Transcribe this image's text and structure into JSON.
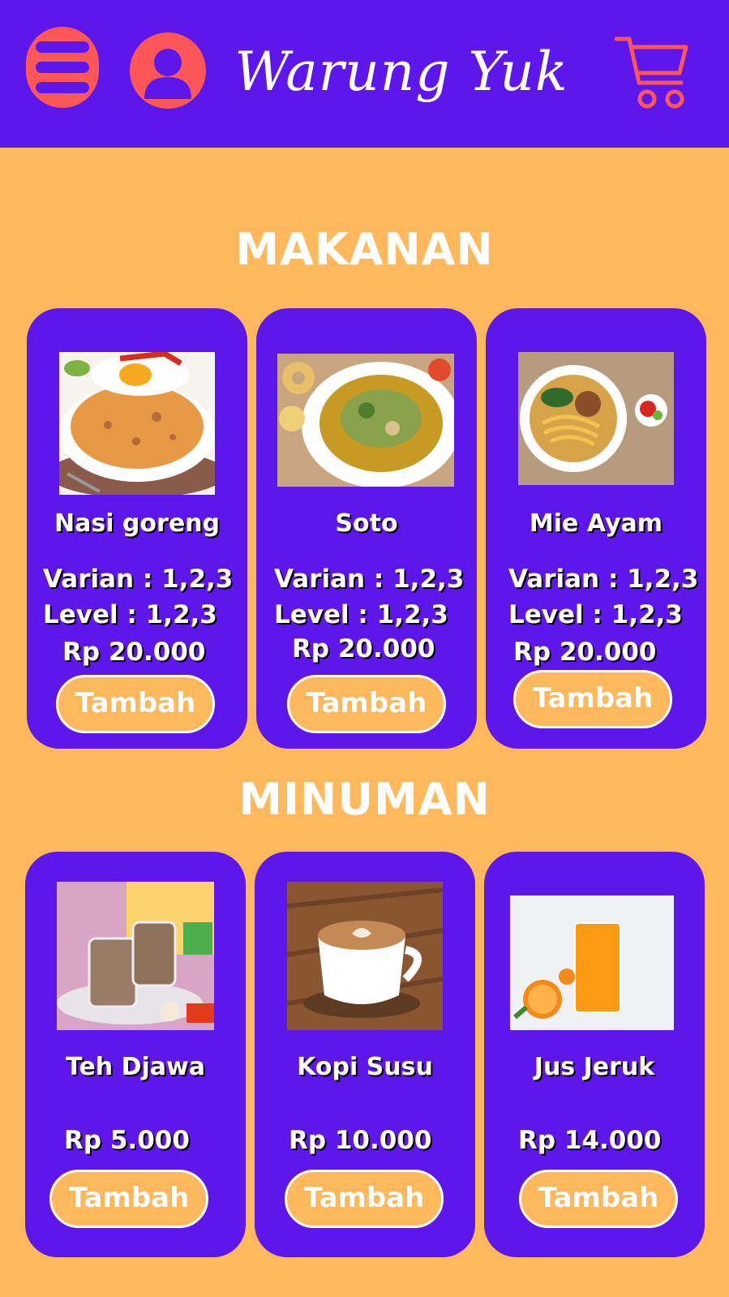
{
  "header": {
    "brand": "Warung Yuk",
    "menu_icon": "hamburger-menu-icon",
    "profile_icon": "user-icon",
    "cart_icon": "cart-icon"
  },
  "colors": {
    "header_bg": "#5D17EB",
    "page_bg": "#FFB85C",
    "accent": "#FF5757",
    "card_bg": "#5D17EB",
    "button_bg": "#FFB85C"
  },
  "sections": [
    {
      "title": "MAKANAN",
      "items": [
        {
          "name": "Nasi goreng",
          "varian": "Varian : 1,2,3",
          "level": "Level : 1,2,3",
          "price": "Rp 20.000",
          "button": "Tambah"
        },
        {
          "name": "Soto",
          "varian": "Varian : 1,2,3",
          "level": "Level : 1,2,3",
          "price": "Rp 20.000",
          "button": "Tambah"
        },
        {
          "name": "Mie Ayam",
          "varian": "Varian : 1,2,3",
          "level": "Level : 1,2,3",
          "price": "Rp 20.000",
          "button": "Tambah"
        }
      ]
    },
    {
      "title": "MINUMAN",
      "items": [
        {
          "name": "Teh Djawa",
          "price": "Rp 5.000",
          "button": "Tambah"
        },
        {
          "name": "Kopi Susu",
          "price": "Rp 10.000",
          "button": "Tambah"
        },
        {
          "name": "Jus Jeruk",
          "price": "Rp 14.000",
          "button": "Tambah"
        }
      ]
    }
  ]
}
